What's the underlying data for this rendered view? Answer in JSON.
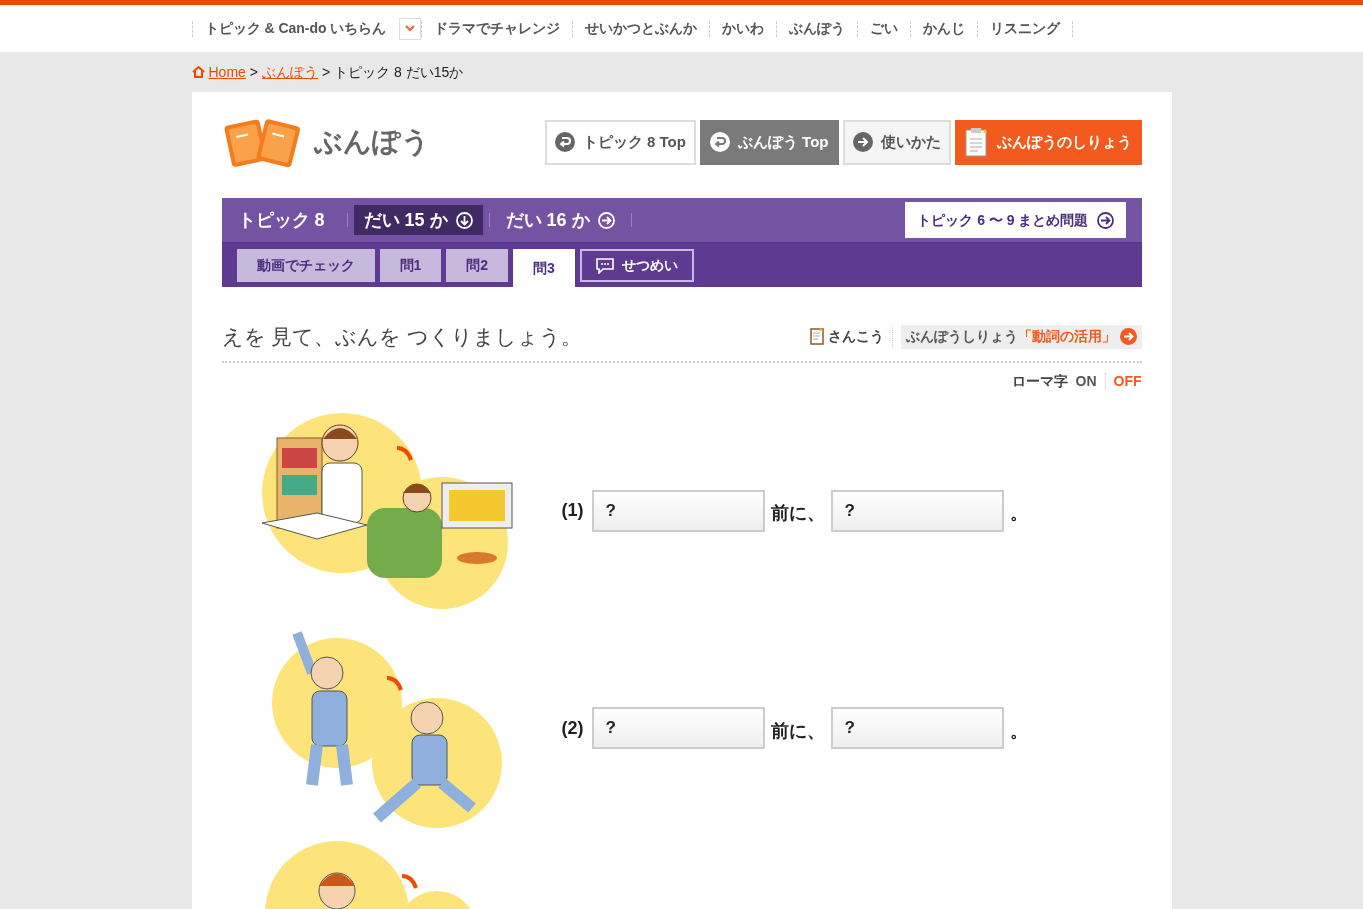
{
  "top_nav": [
    {
      "label": "トピック & Can-do いちらん",
      "dropdown": true
    },
    {
      "label": "ドラマでチャレンジ",
      "dropdown": false
    },
    {
      "label": "せいかつとぶんか",
      "dropdown": false
    },
    {
      "label": "かいわ",
      "dropdown": false
    },
    {
      "label": "ぶんぽう",
      "dropdown": false
    },
    {
      "label": "ごい",
      "dropdown": false
    },
    {
      "label": "かんじ",
      "dropdown": false
    },
    {
      "label": "リスニング",
      "dropdown": false
    }
  ],
  "breadcrumb": {
    "home": "Home",
    "links": [
      "ぶんぽう"
    ],
    "current": "トピック 8 だい15か",
    "separator": ">"
  },
  "header": {
    "title": "ぶんぽう",
    "buttons": [
      {
        "label": "トピック 8 Top",
        "kind": "back"
      },
      {
        "label": "ぶんぽう Top",
        "kind": "back-dark"
      },
      {
        "label": "使いかた",
        "kind": "forward"
      },
      {
        "label": "ぶんぽうのしりょう",
        "kind": "materials"
      }
    ]
  },
  "lesson_nav": {
    "topic": "トピック 8",
    "lessons": [
      {
        "label": "だい 15 か",
        "selected": true
      },
      {
        "label": "だい 16 か",
        "selected": false
      }
    ],
    "summary": "トピック 6 〜 9 まとめ問題"
  },
  "tabs": [
    {
      "label": "動画でチェック",
      "selected": false,
      "kind": "tab"
    },
    {
      "label": "問1",
      "selected": false,
      "kind": "tab"
    },
    {
      "label": "問2",
      "selected": false,
      "kind": "tab"
    },
    {
      "label": "問3",
      "selected": true,
      "kind": "tab"
    },
    {
      "label": "せつめい",
      "selected": false,
      "kind": "explain"
    }
  ],
  "instruction": "えを 見て、ぶんを つくりましょう。",
  "reference": {
    "label": "さんこう",
    "link_prefix": "ぶんぽうしりょう",
    "link_name": "「動詞の活用」"
  },
  "romaji": {
    "label": "ローマ字",
    "options": [
      {
        "label": "ON",
        "selected": false
      },
      {
        "label": "OFF",
        "selected": true
      }
    ]
  },
  "questions": [
    {
      "kind": "question",
      "number": "(1)",
      "answer_1": "?",
      "middle": "前に、",
      "answer_2": "?",
      "end": "。"
    },
    {
      "kind": "question",
      "number": "(2)",
      "answer_1": "?",
      "middle": "前に、",
      "answer_2": "?",
      "end": "。"
    },
    {
      "kind": "illustration"
    }
  ]
}
